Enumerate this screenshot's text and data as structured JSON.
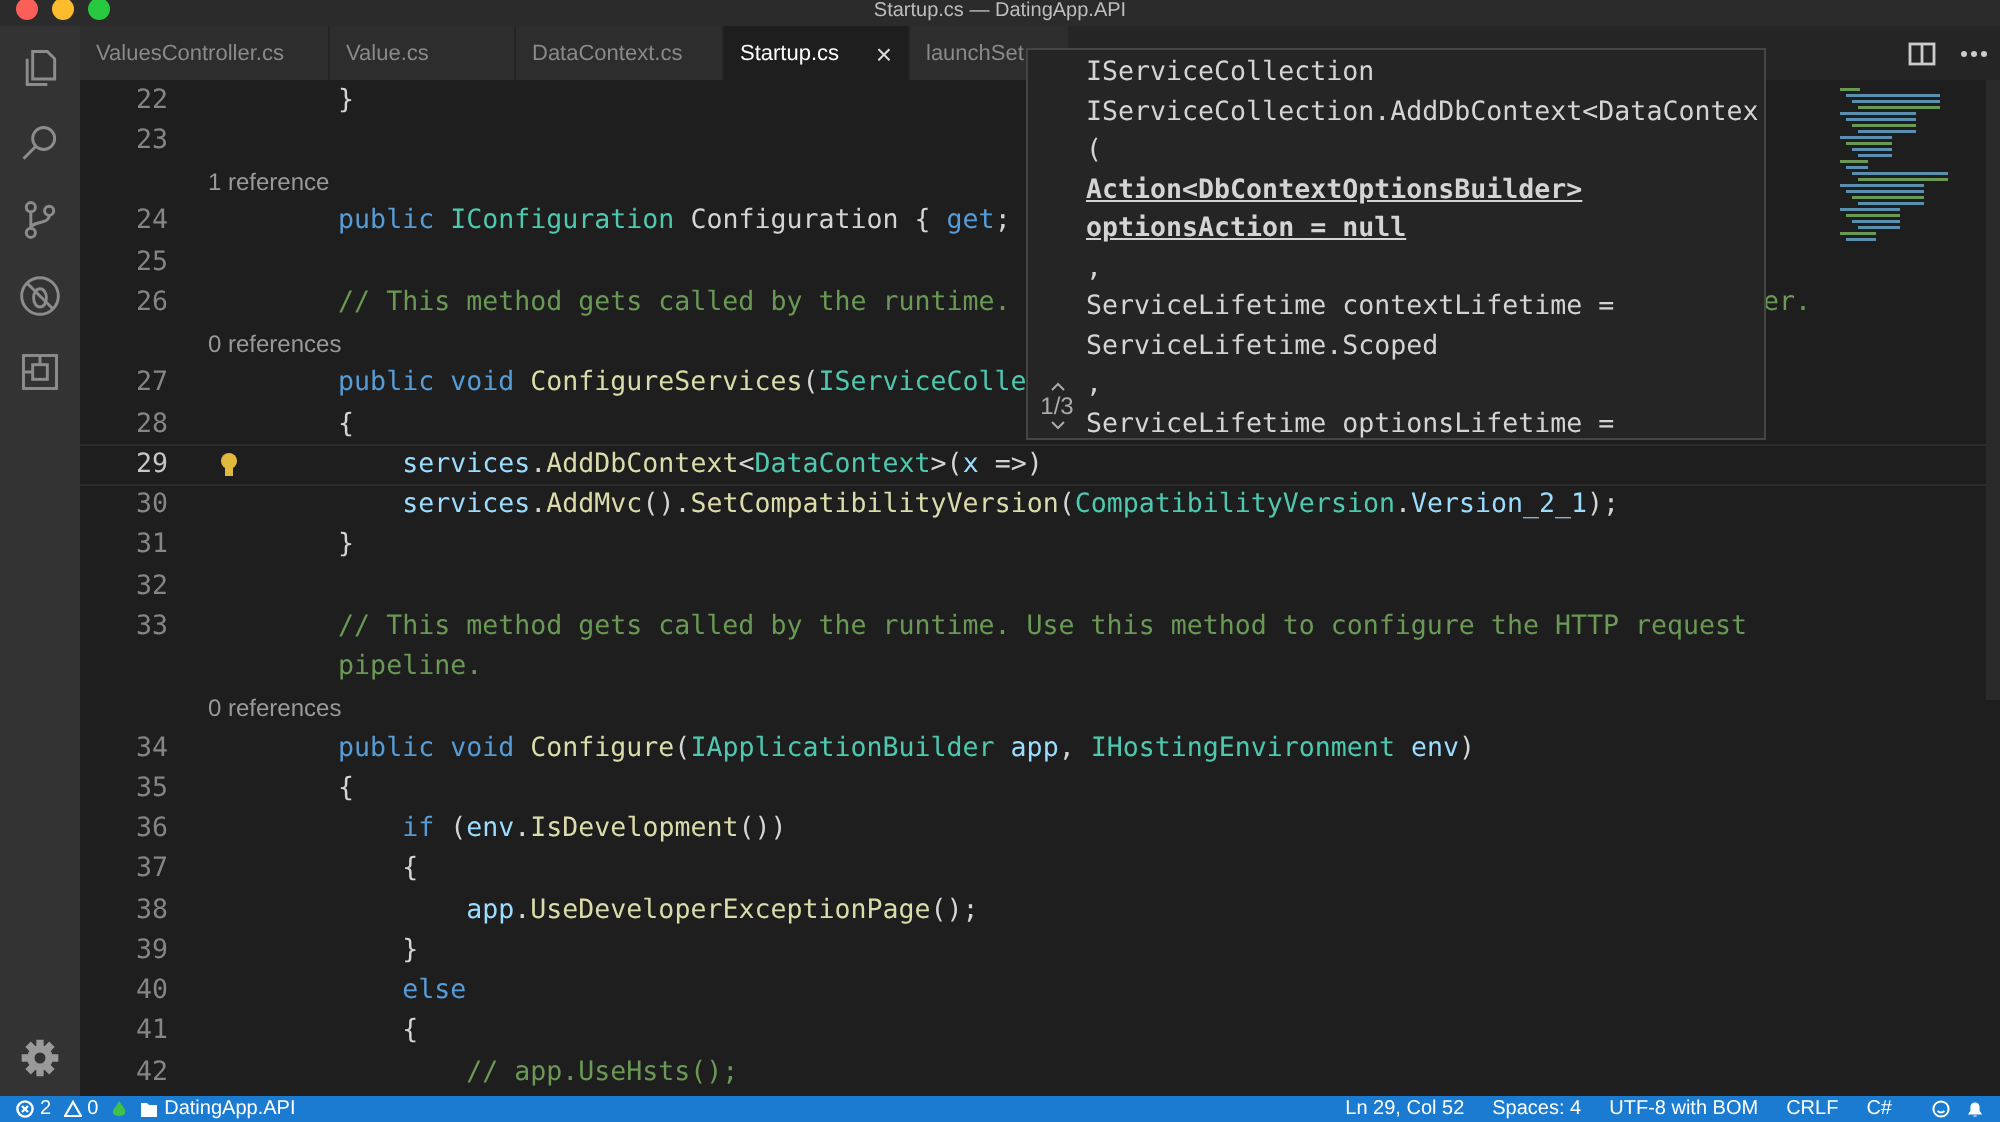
{
  "window": {
    "title": "Startup.cs — DatingApp.API"
  },
  "tabs": [
    {
      "label": "ValuesController.cs",
      "selected": false
    },
    {
      "label": "Value.cs",
      "selected": false
    },
    {
      "label": "DataContext.cs",
      "selected": false
    },
    {
      "label": "Startup.cs",
      "selected": true,
      "close": "×"
    },
    {
      "label": "launchSet",
      "selected": false
    }
  ],
  "editor": {
    "rows": [
      {
        "kind": "code",
        "number": "22",
        "current": false,
        "tokens": [
          {
            "text": "        }",
            "kind": "plain"
          }
        ]
      },
      {
        "kind": "code",
        "number": "23",
        "current": false,
        "tokens": []
      },
      {
        "kind": "codelens",
        "text": "1 reference"
      },
      {
        "kind": "code",
        "number": "24",
        "current": false,
        "tokens": [
          {
            "text": "        public",
            "kind": "kw"
          },
          {
            "text": " IConfiguration",
            "kind": "type"
          },
          {
            "text": " Configuration { ",
            "kind": "plain"
          },
          {
            "text": "get",
            "kind": "kw"
          },
          {
            "text": ";",
            "kind": "plain"
          }
        ]
      },
      {
        "kind": "code",
        "number": "25",
        "current": false,
        "tokens": []
      },
      {
        "kind": "code",
        "number": "26",
        "current": false,
        "tokens": [
          {
            "text": "        // This method gets called by the runtime.",
            "kind": "comment"
          },
          {
            "text": "er.",
            "kind": "tail"
          }
        ]
      },
      {
        "kind": "codelens",
        "text": "0 references"
      },
      {
        "kind": "code",
        "number": "27",
        "current": false,
        "tokens": [
          {
            "text": "        public void",
            "kind": "kw"
          },
          {
            "text": " ConfigureServices",
            "kind": "fn"
          },
          {
            "text": "(",
            "kind": "plain"
          },
          {
            "text": "IServiceColle",
            "kind": "type"
          }
        ]
      },
      {
        "kind": "code",
        "number": "28",
        "current": false,
        "tokens": [
          {
            "text": "        {",
            "kind": "plain"
          }
        ]
      },
      {
        "kind": "code",
        "number": "29",
        "current": true,
        "lightbulb": true,
        "tokens": [
          {
            "text": "            services",
            "kind": "var"
          },
          {
            "text": ".",
            "kind": "plain"
          },
          {
            "text": "AddDbContext",
            "kind": "fn"
          },
          {
            "text": "<",
            "kind": "plain"
          },
          {
            "text": "DataContext",
            "kind": "type"
          },
          {
            "text": ">(",
            "kind": "plain"
          },
          {
            "text": "x",
            "kind": "var"
          },
          {
            "text": " =>)",
            "kind": "plain"
          }
        ]
      },
      {
        "kind": "code",
        "number": "30",
        "current": false,
        "tokens": [
          {
            "text": "            services",
            "kind": "var"
          },
          {
            "text": ".",
            "kind": "plain"
          },
          {
            "text": "AddMvc",
            "kind": "fn"
          },
          {
            "text": "().",
            "kind": "plain"
          },
          {
            "text": "SetCompatibilityVersion",
            "kind": "fn"
          },
          {
            "text": "(",
            "kind": "plain"
          },
          {
            "text": "CompatibilityVersion",
            "kind": "type"
          },
          {
            "text": ".",
            "kind": "plain"
          },
          {
            "text": "Version_2_1",
            "kind": "var"
          },
          {
            "text": ");",
            "kind": "plain"
          }
        ]
      },
      {
        "kind": "code",
        "number": "31",
        "current": false,
        "tokens": [
          {
            "text": "        }",
            "kind": "plain"
          }
        ]
      },
      {
        "kind": "code",
        "number": "32",
        "current": false,
        "tokens": []
      },
      {
        "kind": "code",
        "number": "33",
        "current": false,
        "tokens": [
          {
            "text": "        // This method gets called by the runtime. Use this method to configure the HTTP request",
            "kind": "comment"
          }
        ]
      },
      {
        "kind": "wrap",
        "tokens": [
          {
            "text": "        pipeline.",
            "kind": "comment"
          }
        ]
      },
      {
        "kind": "codelens",
        "text": "0 references"
      },
      {
        "kind": "code",
        "number": "34",
        "current": false,
        "tokens": [
          {
            "text": "        public void",
            "kind": "kw"
          },
          {
            "text": " Configure",
            "kind": "fn"
          },
          {
            "text": "(",
            "kind": "plain"
          },
          {
            "text": "IApplicationBuilder",
            "kind": "type"
          },
          {
            "text": " app",
            "kind": "var"
          },
          {
            "text": ", ",
            "kind": "plain"
          },
          {
            "text": "IHostingEnvironment",
            "kind": "type"
          },
          {
            "text": " env",
            "kind": "var"
          },
          {
            "text": ")",
            "kind": "plain"
          }
        ]
      },
      {
        "kind": "code",
        "number": "35",
        "current": false,
        "tokens": [
          {
            "text": "        {",
            "kind": "plain"
          }
        ]
      },
      {
        "kind": "code",
        "number": "36",
        "current": false,
        "tokens": [
          {
            "text": "            if",
            "kind": "kw"
          },
          {
            "text": " (",
            "kind": "plain"
          },
          {
            "text": "env",
            "kind": "var"
          },
          {
            "text": ".",
            "kind": "plain"
          },
          {
            "text": "IsDevelopment",
            "kind": "fn"
          },
          {
            "text": "())",
            "kind": "plain"
          }
        ]
      },
      {
        "kind": "code",
        "number": "37",
        "current": false,
        "tokens": [
          {
            "text": "            {",
            "kind": "plain"
          }
        ]
      },
      {
        "kind": "code",
        "number": "38",
        "current": false,
        "tokens": [
          {
            "text": "                app",
            "kind": "var"
          },
          {
            "text": ".",
            "kind": "plain"
          },
          {
            "text": "UseDeveloperExceptionPage",
            "kind": "fn"
          },
          {
            "text": "();",
            "kind": "plain"
          }
        ]
      },
      {
        "kind": "code",
        "number": "39",
        "current": false,
        "tokens": [
          {
            "text": "            }",
            "kind": "plain"
          }
        ]
      },
      {
        "kind": "code",
        "number": "40",
        "current": false,
        "tokens": [
          {
            "text": "            else",
            "kind": "kw"
          }
        ]
      },
      {
        "kind": "code",
        "number": "41",
        "current": false,
        "tokens": [
          {
            "text": "            {",
            "kind": "plain"
          }
        ]
      },
      {
        "kind": "code",
        "number": "42",
        "current": false,
        "tokens": [
          {
            "text": "                // app.UseHsts();",
            "kind": "comment"
          }
        ]
      }
    ]
  },
  "signature_popup": {
    "counter": "1/3",
    "lines": [
      {
        "text": "IServiceCollection",
        "active": false
      },
      {
        "text": "IServiceCollection.AddDbContext<DataContex",
        "active": false
      },
      {
        "text": "(",
        "active": false
      },
      {
        "text": "Action<DbContextOptionsBuilder>",
        "active": true
      },
      {
        "text": "optionsAction = null",
        "active": true
      },
      {
        "text": ",",
        "active": false
      },
      {
        "text": "ServiceLifetime contextLifetime =",
        "active": false
      },
      {
        "text": "ServiceLifetime.Scoped",
        "active": false
      },
      {
        "text": ",",
        "active": false
      },
      {
        "text": "ServiceLifetime optionsLifetime =",
        "active": false
      }
    ]
  },
  "status_bar": {
    "errors": "2",
    "warnings": "0",
    "folder": "DatingApp.API",
    "right": [
      "Ln 29, Col 52",
      "Spaces: 4",
      "UTF-8 with BOM",
      "CRLF",
      "C#"
    ]
  }
}
